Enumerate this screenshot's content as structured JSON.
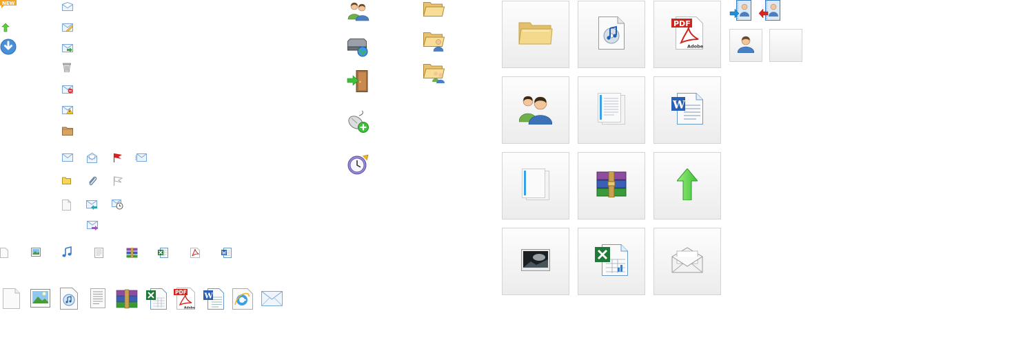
{
  "labels": {
    "new_badge": "NEW",
    "pdf": "PDF",
    "adobe": "Adobe",
    "word": "W"
  },
  "colors": {
    "tile_border": "#d4d4d4",
    "folder_yellow": "#f2d27a",
    "envelope_blue": "#7aa7d8",
    "green_arrow": "#5fcf3a",
    "pdf_red": "#d0261d",
    "winrar_purple": "#8e4c9e",
    "excel_green": "#1f7a3a",
    "word_blue": "#2b5fb4",
    "user_blue": "#4b7fc4",
    "user_green": "#6fb04b"
  },
  "icons": {
    "small_column_a": [
      "new-badge-icon",
      "arrow-up-small-icon",
      "download-circle-icon"
    ],
    "small_column_b": [
      "mail-open-icon",
      "mail-edit-icon",
      "mail-forward-icon",
      "trash-icon",
      "mail-remove-icon",
      "mail-warning-icon",
      "folder-brown-icon"
    ],
    "mail_grid": [
      "envelope-icon",
      "mail-read-icon",
      "flag-red-icon",
      "mail-lines-icon",
      "folder-small-icon",
      "paperclip-icon",
      "flag-outline-icon",
      "blank-file-icon",
      "mail-receive-icon",
      "mail-schedule-icon",
      "mail-send-icon"
    ],
    "file_types_small": [
      "blank-file-icon",
      "image-file-icon",
      "music-note-icon",
      "text-file-icon",
      "archive-file-icon",
      "excel-file-icon",
      "pdf-file-icon",
      "word-file-icon"
    ],
    "file_types_medium": [
      "blank-page-icon",
      "image-page-icon",
      "music-page-icon",
      "text-page-icon",
      "winrar-icon",
      "excel-page-icon",
      "pdf-page-icon",
      "word-page-icon",
      "ie-page-icon",
      "envelope-large-icon"
    ],
    "middle_column": [
      "users-icon",
      "network-drive-icon",
      "logout-door-icon",
      "mouse-add-icon",
      "clock-icon"
    ],
    "folders_column": [
      "folder-open-icon",
      "folder-user-icon",
      "folder-users-icon"
    ],
    "tiles": [
      "folder-large-icon",
      "music-cd-icon",
      "pdf-large-icon",
      "users-large-icon",
      "text-doc-large-icon",
      "word-large-icon",
      "blank-doc-large-icon",
      "winrar-large-icon",
      "green-arrow-up-icon",
      "image-large-icon",
      "excel-large-icon",
      "envelope-open-large-icon"
    ],
    "contacts": [
      "contact-import-icon",
      "contact-export-icon",
      "user-tile-icon",
      "empty-tile"
    ]
  }
}
